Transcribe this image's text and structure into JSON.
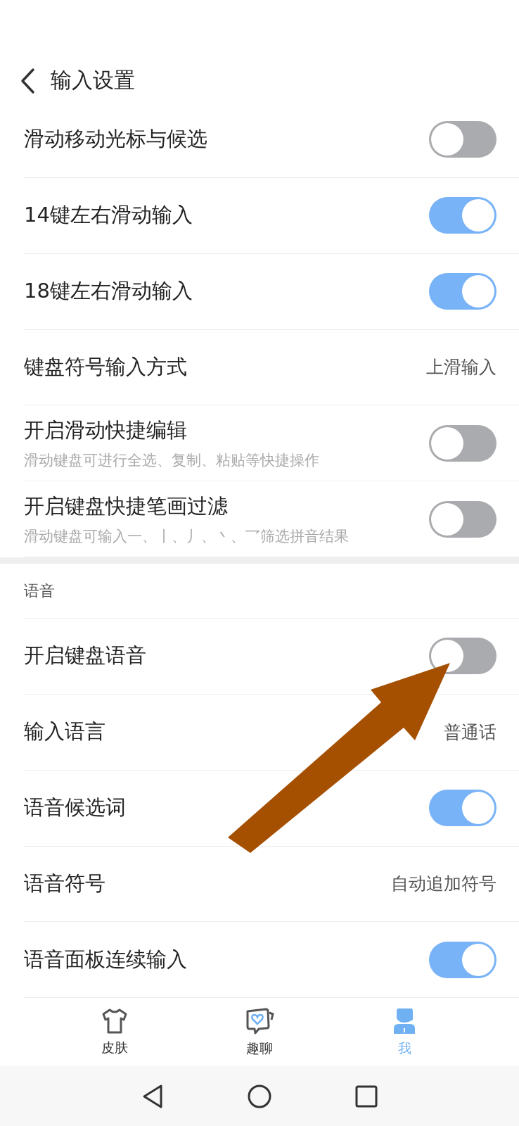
{
  "header": {
    "title": "输入设置"
  },
  "groups": [
    {
      "rows": [
        {
          "kind": "toggle",
          "title": "滑动移动光标与候选",
          "on": false
        },
        {
          "kind": "toggle",
          "title": "14键左右滑动输入",
          "on": true
        },
        {
          "kind": "toggle",
          "title": "18键左右滑动输入",
          "on": true
        },
        {
          "kind": "value",
          "title": "键盘符号输入方式",
          "value": "上滑输入"
        },
        {
          "kind": "toggle",
          "title": "开启滑动快捷编辑",
          "subtitle": "滑动键盘可进行全选、复制、粘贴等快捷操作",
          "on": false
        },
        {
          "kind": "toggle",
          "title": "开启键盘快捷笔画过滤",
          "subtitle": "滑动键盘可输入一、丨、丿、丶、乛筛选拼音结果",
          "on": false
        }
      ]
    },
    {
      "label": "语音",
      "rows": [
        {
          "kind": "toggle",
          "title": "开启键盘语音",
          "on": false
        },
        {
          "kind": "value",
          "title": "输入语言",
          "value": "普通话"
        },
        {
          "kind": "toggle",
          "title": "语音候选词",
          "on": true
        },
        {
          "kind": "value",
          "title": "语音符号",
          "value": "自动追加符号"
        },
        {
          "kind": "toggle",
          "title": "语音面板连续输入",
          "on": true
        }
      ]
    }
  ],
  "tabs": [
    {
      "kind": "shirt",
      "label": "皮肤",
      "selected": false
    },
    {
      "kind": "chat",
      "label": "趣聊",
      "selected": false
    },
    {
      "kind": "person",
      "label": "我",
      "selected": true
    }
  ],
  "annotation": {
    "kind": "arrow"
  }
}
